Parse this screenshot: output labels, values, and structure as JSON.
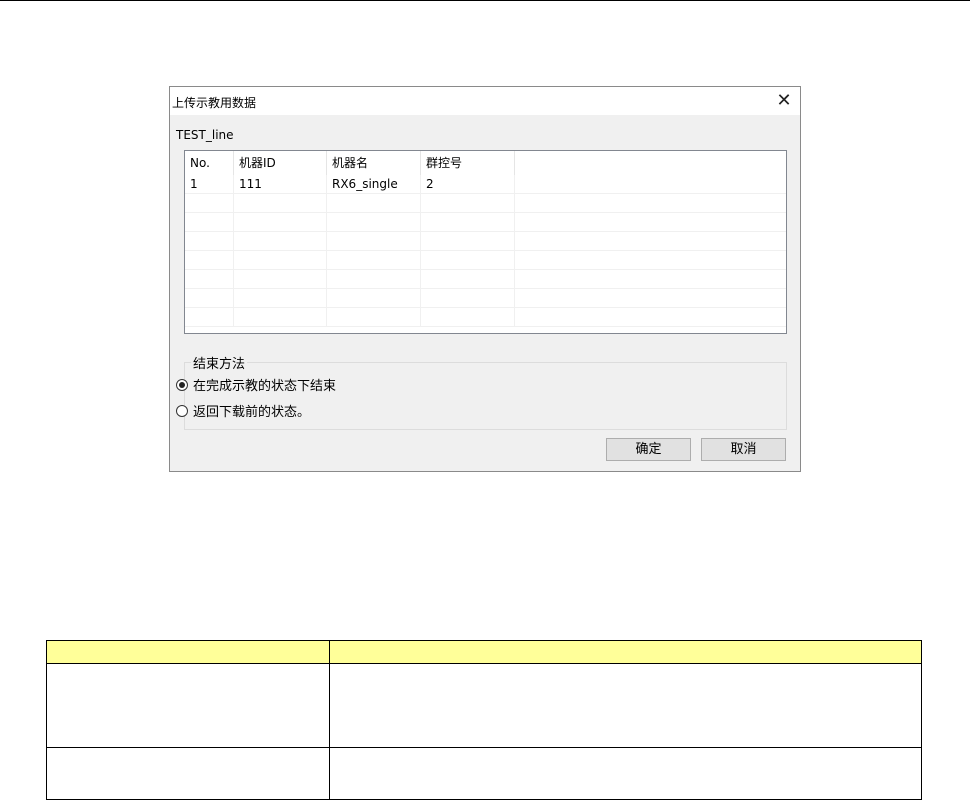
{
  "dialog": {
    "title": "上传示教用数据",
    "close_glyph": "✕",
    "line_name": "TEST_line",
    "list": {
      "columns": [
        "No.",
        "机器ID",
        "机器名",
        "群控号",
        ""
      ],
      "rows": [
        [
          "1",
          "111",
          "RX6_single",
          "2",
          ""
        ]
      ],
      "empty_rows": 7
    },
    "end_method": {
      "label": "结束方法",
      "options": [
        {
          "label": "在完成示教的状态下结束",
          "checked": true
        },
        {
          "label": "返回下载前的状态。",
          "checked": false
        }
      ]
    },
    "ok_label": "确定",
    "cancel_label": "取消"
  },
  "doc_table": {
    "header": [
      "",
      ""
    ],
    "rows": [
      [
        "",
        ""
      ],
      [
        "",
        ""
      ]
    ]
  }
}
